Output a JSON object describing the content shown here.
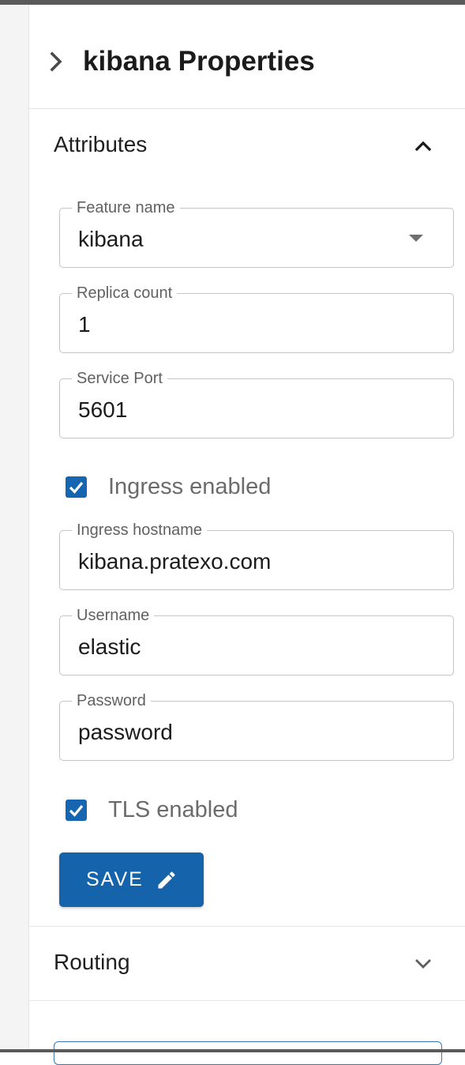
{
  "panel": {
    "title": "kibana Properties"
  },
  "attributes": {
    "title": "Attributes",
    "expanded": true,
    "fields": {
      "feature_name": {
        "label": "Feature name",
        "value": "kibana"
      },
      "replica_count": {
        "label": "Replica count",
        "value": "1"
      },
      "service_port": {
        "label": "Service Port",
        "value": "5601"
      },
      "ingress_hostname": {
        "label": "Ingress hostname",
        "value": "kibana.pratexo.com"
      },
      "username": {
        "label": "Username",
        "value": "elastic"
      },
      "password": {
        "label": "Password",
        "value": "password"
      }
    },
    "ingress_enabled": {
      "label": "Ingress enabled",
      "checked": true
    },
    "tls_enabled": {
      "label": "TLS enabled",
      "checked": true
    },
    "save_label": "SAVE"
  },
  "routing": {
    "title": "Routing",
    "expanded": false
  },
  "icons": {
    "panel_toggle": "chevron-right-icon",
    "attributes_toggle": "chevron-up-icon",
    "routing_toggle": "chevron-down-icon",
    "feature_dropdown": "caret-down-icon",
    "save": "pencil-icon",
    "checkbox": "check-icon"
  },
  "colors": {
    "primary": "#1563ab",
    "checkbox": "#1565b0",
    "outline": "#c4c4c4",
    "label": "#616161"
  }
}
